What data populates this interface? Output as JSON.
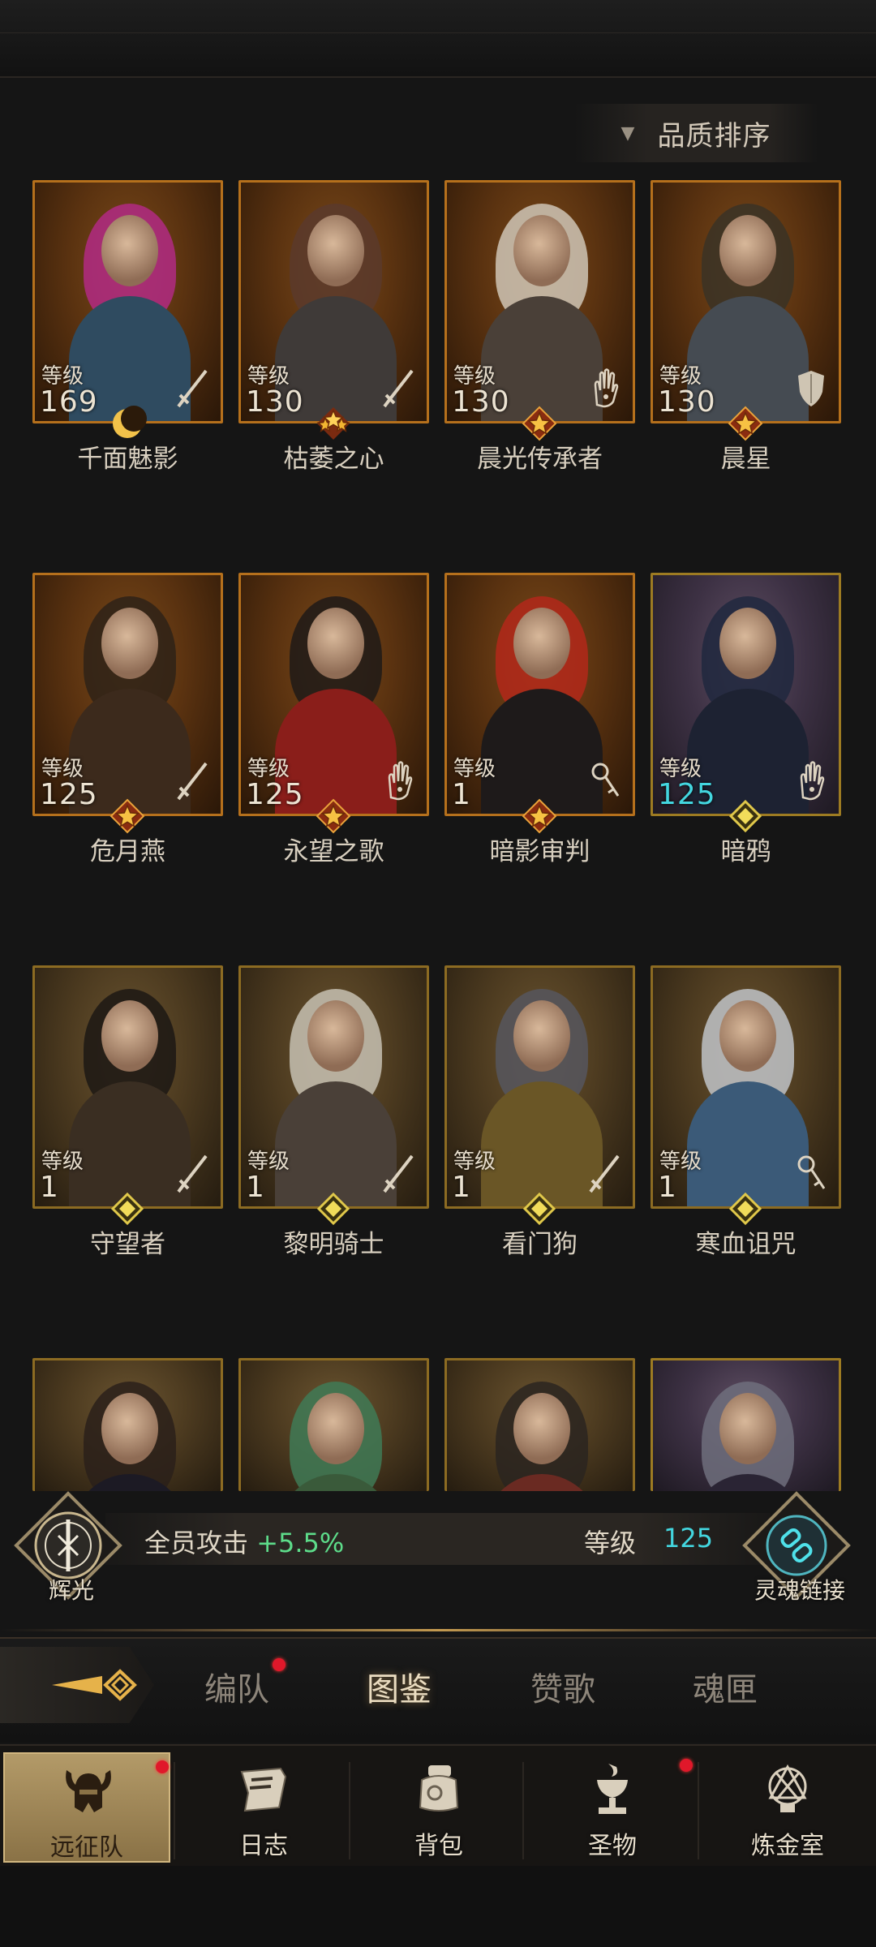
{
  "sort_button": {
    "label": "品质排序",
    "icon": "triangle-down-icon"
  },
  "heroes": [
    {
      "name": "千面魅影",
      "level_label": "等级",
      "level": "169",
      "class_icon": "sword-icon",
      "rank_icon": "moon-icon",
      "theme": "gold",
      "hair": "#b12a84",
      "body": "#2f4b60"
    },
    {
      "name": "枯萎之心",
      "level_label": "等级",
      "level": "130",
      "class_icon": "sword-icon",
      "rank_icon": "triple-star-icon",
      "theme": "gold",
      "hair": "#5a3a2c",
      "body": "#3f3a38"
    },
    {
      "name": "晨光传承者",
      "level_label": "等级",
      "level": "130",
      "class_icon": "palm-icon",
      "rank_icon": "star-icon",
      "theme": "gold",
      "hair": "#cfc5b6",
      "body": "#4a4038"
    },
    {
      "name": "晨星",
      "level_label": "等级",
      "level": "130",
      "class_icon": "shield-icon",
      "rank_icon": "star-icon",
      "theme": "gold",
      "hair": "#3a3226",
      "body": "#454b52"
    },
    {
      "name": "危月燕",
      "level_label": "等级",
      "level": "125",
      "class_icon": "sword-icon",
      "rank_icon": "star-icon",
      "theme": "gold",
      "hair": "#2e2218",
      "body": "#3c2a1c"
    },
    {
      "name": "永望之歌",
      "level_label": "等级",
      "level": "125",
      "class_icon": "palm-icon",
      "rank_icon": "star-icon",
      "theme": "gold",
      "hair": "#1f1a18",
      "body": "#8a1e1a"
    },
    {
      "name": "暗影审判",
      "level_label": "等级",
      "level": "1",
      "class_icon": "key-icon",
      "rank_icon": "star-icon",
      "theme": "gold",
      "hair": "#b3281a",
      "body": "#1e1a1a"
    },
    {
      "name": "暗鸦",
      "level_label": "等级",
      "level": "125",
      "class_icon": "palm-icon",
      "rank_icon": "diamond-icon",
      "theme": "purple",
      "hair": "#20283e",
      "body": "#1d2232",
      "cyan": true
    },
    {
      "name": "守望者",
      "level_label": "等级",
      "level": "1",
      "class_icon": "sword-icon",
      "rank_icon": "diamond-icon",
      "theme": "tan",
      "hair": "#1c1814",
      "body": "#3a2e22"
    },
    {
      "name": "黎明骑士",
      "level_label": "等级",
      "level": "1",
      "class_icon": "sword-icon",
      "rank_icon": "diamond-icon",
      "theme": "tan",
      "hair": "#c7c1b3",
      "body": "#4a4038"
    },
    {
      "name": "看门狗",
      "level_label": "等级",
      "level": "1",
      "class_icon": "sword-icon",
      "rank_icon": "diamond-icon",
      "theme": "tan",
      "hair": "#56565e",
      "body": "#6a5626"
    },
    {
      "name": "寒血诅咒",
      "level_label": "等级",
      "level": "1",
      "class_icon": "key-icon",
      "rank_icon": "diamond-icon",
      "theme": "tan",
      "hair": "#bfc3c8",
      "body": "#3b5a78"
    },
    {
      "name": "",
      "theme": "tan",
      "hair": "#2a201a",
      "body": "#1c1a24",
      "partial": true
    },
    {
      "name": "",
      "theme": "tan",
      "hair": "#3f7a56",
      "body": "#3a5a3a",
      "partial": true
    },
    {
      "name": "",
      "theme": "tan",
      "hair": "#2a2420",
      "body": "#6a2a22",
      "partial": true
    },
    {
      "name": "",
      "theme": "purple",
      "hair": "#6e6f7c",
      "body": "#2a2434",
      "partial": true
    }
  ],
  "bonus": {
    "left_emblem_label": "辉光",
    "left_emblem_icon": "compass-sword-icon",
    "text": "全员攻击",
    "value": "+5.5%",
    "level_label": "等级",
    "level_value": "125",
    "right_emblem_label": "灵魂链接",
    "right_emblem_icon": "chain-link-icon"
  },
  "tabs": [
    {
      "label": "编队",
      "active": false,
      "dot": true
    },
    {
      "label": "图鉴",
      "active": true,
      "dot": false
    },
    {
      "label": "赞歌",
      "active": false,
      "dot": false
    },
    {
      "label": "魂匣",
      "active": false,
      "dot": false
    }
  ],
  "nav": [
    {
      "label": "远征队",
      "icon": "horned-helmet-icon",
      "active": true,
      "dot": true
    },
    {
      "label": "日志",
      "icon": "scroll-icon",
      "active": false,
      "dot": false
    },
    {
      "label": "背包",
      "icon": "pouch-icon",
      "active": false,
      "dot": false
    },
    {
      "label": "圣物",
      "icon": "chalice-icon",
      "active": false,
      "dot": true
    },
    {
      "label": "炼金室",
      "icon": "alchemy-icon",
      "active": false,
      "dot": false
    }
  ],
  "colors": {
    "accent_gold": "#c49a50",
    "cyan": "#43d6df",
    "green": "#5ddc8a",
    "badge_red": "#e0182a"
  }
}
